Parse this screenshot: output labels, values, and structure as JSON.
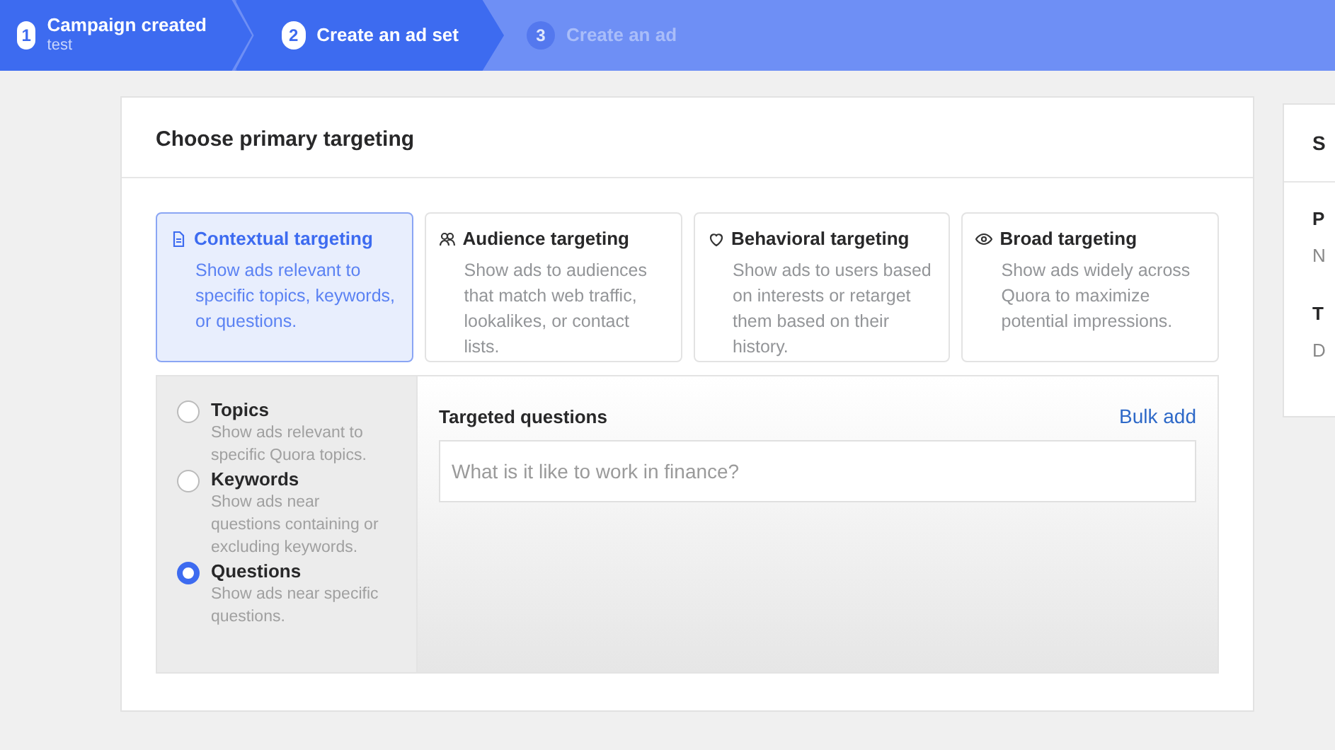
{
  "steps": [
    {
      "number": "1",
      "label": "Campaign created",
      "sublabel": "test",
      "kind": "done"
    },
    {
      "number": "2",
      "label": "Create an ad set",
      "kind": "current"
    },
    {
      "number": "3",
      "label": "Create an ad",
      "kind": "upcoming"
    }
  ],
  "card": {
    "title": "Choose primary targeting",
    "targeting_options": [
      {
        "kind": "document",
        "title": "Contextual targeting",
        "description": "Show ads relevant to specific topics, keywords, or questions.",
        "selected": true
      },
      {
        "kind": "people",
        "title": "Audience targeting",
        "description": "Show ads to audiences that match web traffic, lookalikes, or contact lists.",
        "selected": false
      },
      {
        "kind": "heart",
        "title": "Behavioral targeting",
        "description": "Show ads to users based on interests or retarget them based on their history.",
        "selected": false
      },
      {
        "kind": "eye",
        "title": "Broad targeting",
        "description": "Show ads widely across Quora to maximize potential impressions.",
        "selected": false
      }
    ],
    "contextual_types": [
      {
        "label": "Topics",
        "description": "Show ads relevant to specific Quora topics.",
        "selected": false
      },
      {
        "label": "Keywords",
        "description": "Show ads near questions containing or excluding keywords.",
        "selected": false
      },
      {
        "label": "Questions",
        "description": "Show ads near specific questions.",
        "selected": true
      }
    ],
    "targeted_questions": {
      "label": "Targeted questions",
      "link": "Bulk add",
      "placeholder": "What is it like to work in finance?"
    }
  },
  "side_card": {
    "title": "S",
    "rows": [
      {
        "label": "P",
        "value": "N"
      },
      {
        "label": "T",
        "value": "D"
      }
    ]
  }
}
